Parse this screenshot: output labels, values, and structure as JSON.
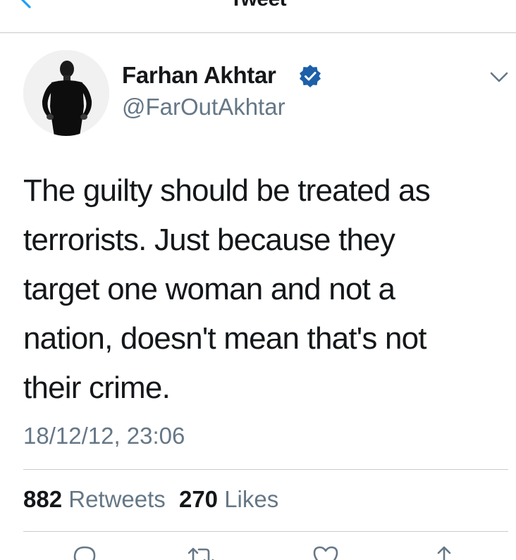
{
  "nav": {
    "title": "Tweet"
  },
  "tweet": {
    "display_name": "Farhan Akhtar",
    "handle": "@FarOutAkhtar",
    "text": "The guilty should be treated as\nterrorists. Just because they\ntarget one woman and not a\nnation, doesn't mean that's not\ntheir crime.",
    "timestamp": "18/12/12, 23:06"
  },
  "stats": {
    "retweets_count": "882",
    "retweets_label": "Retweets",
    "likes_count": "270",
    "likes_label": "Likes"
  },
  "icons": {
    "back": "chevron-left-icon",
    "verified": "verified-badge-icon",
    "menu": "chevron-down-icon",
    "reply": "reply-icon",
    "retweet": "retweet-icon",
    "like": "heart-icon",
    "share": "share-icon"
  },
  "colors": {
    "accent": "#1da1f2",
    "verified": "#1da1f2",
    "text": "#14171a",
    "secondary_text": "#657786",
    "divider": "#c8ccd0"
  }
}
